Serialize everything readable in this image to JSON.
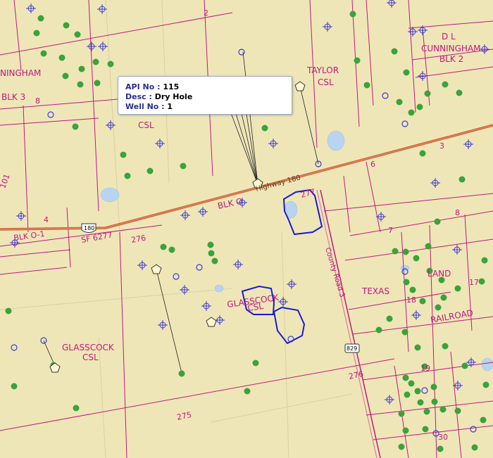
{
  "tooltip": {
    "rows": [
      {
        "key": "API No",
        "value": "115"
      },
      {
        "key": "Desc",
        "value": "Dry Hole"
      },
      {
        "key": "Well No",
        "value": "1"
      }
    ]
  },
  "labels": {
    "dl": "D L",
    "cunningham_top": "CUNNINGHAM",
    "blk2": "BLK 2",
    "cunningham_left": "NINGHAM",
    "blk3": "BLK 3",
    "taylor": "TAYLOR",
    "taylor_csl": "CSL",
    "csl_mid": "CSL",
    "blk_o": "BLK O",
    "blk_o1": "BLK O-1",
    "sf": "SF 6277",
    "glasscock_mid": "GLASSCOCK",
    "glasscock_mid_csl": "CSL",
    "glasscock_left": "GLASSCOCK",
    "glasscock_left_csl": "CSL",
    "texas": "TEXAS",
    "land": "LAND",
    "railroad": "RAILROAD",
    "highway": "Highway 180",
    "county_road": "County Road 3",
    "shield_180": "180",
    "shield_829": "829"
  },
  "section_numbers": {
    "n2": "2",
    "n8a": "8",
    "n3": "3",
    "n4": "4",
    "n6": "6",
    "n8b": "8",
    "n7": "7",
    "n17": "17",
    "n18": "18",
    "n19": "19",
    "n30": "30",
    "n101": "101",
    "n276a": "276",
    "n277": "277",
    "n275": "275",
    "n276b": "276"
  },
  "colors": {
    "background": "#efe6b8",
    "grid_line": "#c2187a",
    "highway": "#d2693c",
    "water": "#b8d4ee",
    "well_green": "#3aa33a",
    "well_blue": "#3a3ad0",
    "selection": "#1a1ad8"
  }
}
